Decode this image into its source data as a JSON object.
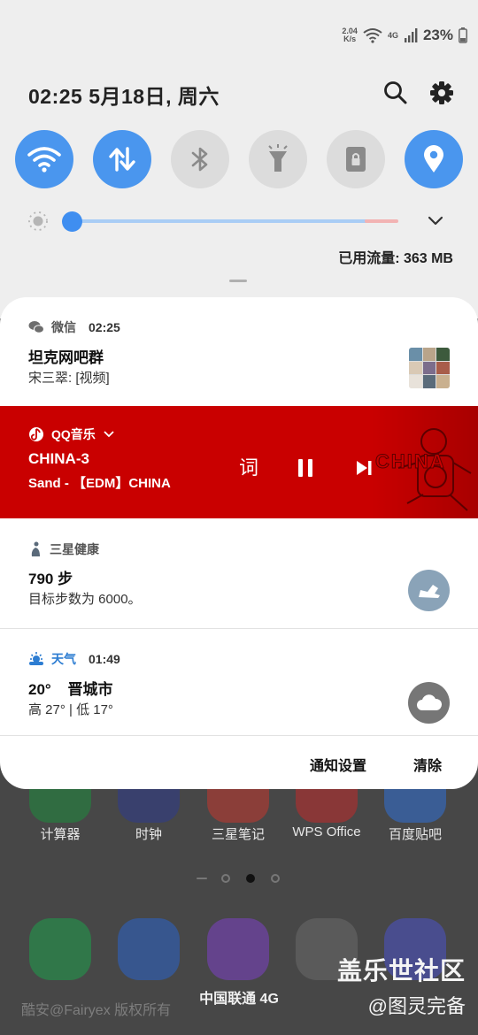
{
  "status_bar": {
    "speed_value": "2.04",
    "speed_unit": "K/s",
    "network_label": "4G",
    "battery_percent": "23%"
  },
  "header": {
    "datetime": "02:25  5月18日, 周六"
  },
  "quick_toggles": [
    {
      "name": "wifi",
      "state": "on"
    },
    {
      "name": "mobile-data",
      "state": "on"
    },
    {
      "name": "bluetooth",
      "state": "off"
    },
    {
      "name": "flashlight",
      "state": "off"
    },
    {
      "name": "screen-lock",
      "state": "off"
    },
    {
      "name": "location",
      "state": "on"
    }
  ],
  "brightness": {
    "level": 0.02
  },
  "data_usage": "已用流量: 363 MB",
  "notifications": {
    "wechat": {
      "app": "微信",
      "time": "02:25",
      "title": "坦克网吧群",
      "text": "宋三翠: [视频]"
    },
    "music": {
      "app": "QQ音乐",
      "title": "CHINA-3",
      "text": "Sand - 【EDM】CHINA",
      "lyrics_label": "词",
      "art_text": "CHINA",
      "accent": "#c90000"
    },
    "health": {
      "app": "三星健康",
      "title": "790 步",
      "text": "目标步数为 6000。"
    },
    "weather": {
      "app": "天气",
      "time": "01:49",
      "temp": "20°",
      "city": "晋城市",
      "range": "高 27°  | 低 17°"
    },
    "footer": {
      "settings_label": "通知设置",
      "clear_label": "清除"
    }
  },
  "home_apps": [
    "计算器",
    "时钟",
    "三星笔记",
    "WPS Office",
    "百度贴吧"
  ],
  "carrier": "中国联通 4G",
  "watermarks": {
    "left": "酷安@Fairyex 版权所有",
    "right_line1": "盖乐世社区",
    "right_line2": "@图灵完备"
  },
  "colors": {
    "accent_blue": "#4a96ee",
    "music_red": "#c90000",
    "panel_bg": "#eeeeee"
  }
}
